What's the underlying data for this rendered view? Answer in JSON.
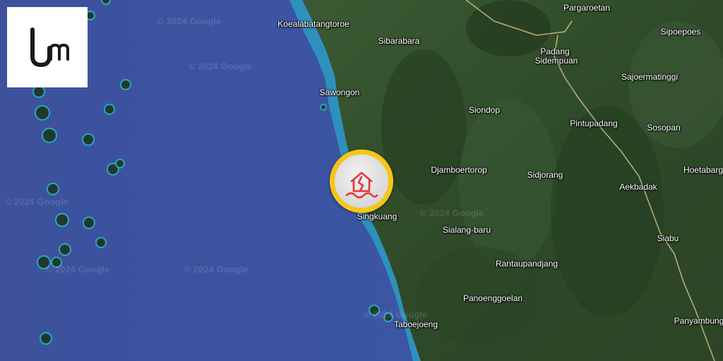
{
  "map": {
    "places": [
      {
        "name": "Koealabatangtoroe"
      },
      {
        "name": "Sibarabara"
      },
      {
        "name": "Pargaroetan"
      },
      {
        "name": "Sipoepoes"
      },
      {
        "name": "Padang"
      },
      {
        "name": "Sidempuan"
      },
      {
        "name": "Sajoermatinggi"
      },
      {
        "name": "Sawongon"
      },
      {
        "name": "Siondop"
      },
      {
        "name": "Pintupadang"
      },
      {
        "name": "Sosopan"
      },
      {
        "name": "Djamboertorop"
      },
      {
        "name": "Sidjorang"
      },
      {
        "name": "Hoetabarg"
      },
      {
        "name": "Aekbadak"
      },
      {
        "name": "Singkuang"
      },
      {
        "name": "Sialang-baru"
      },
      {
        "name": "Siabu"
      },
      {
        "name": "Rantaupandjang"
      },
      {
        "name": "Panoenggoelan"
      },
      {
        "name": "Taboejoeng"
      },
      {
        "name": "Panyambung"
      }
    ],
    "watermark": "© 2024 Google"
  },
  "logo": {
    "name": "logo-icon"
  },
  "marker": {
    "icon": "earthquake-house-icon",
    "ring_color": "#f5c518",
    "icon_color": "#e8363a"
  },
  "colors": {
    "ocean": "#3a4f9a",
    "land": "#2f4a2a",
    "shallow_water": "#2aa6c6",
    "road": "#d9c48a"
  }
}
